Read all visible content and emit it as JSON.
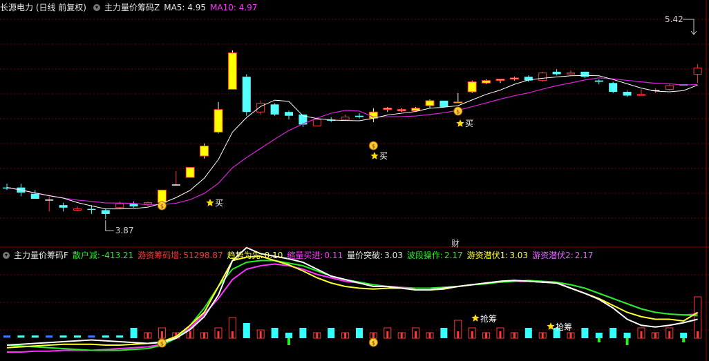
{
  "top_panel": {
    "title": "长源电力 (日线 前复权)",
    "indicator": "主力量价筹码Z",
    "ma5_label": "MA5: 4.95",
    "ma10_label": "MA10: 4.97",
    "high_label": "5.42",
    "low_label": "3.87",
    "buy_label": "买",
    "cai_label": "财"
  },
  "bottom_panel": {
    "indicator": "主力量价筹码F",
    "metrics": [
      {
        "label": "散户减:",
        "value": "-413.21",
        "color": "#22ee22"
      },
      {
        "label": "游资筹码增:",
        "value": "51298.87",
        "color": "#ff3838"
      },
      {
        "label": "趋势为先:",
        "value": "0.10",
        "color": "#ffff33"
      },
      {
        "label": "缩量买进:",
        "value": "0.11",
        "color": "#ff33ff"
      },
      {
        "label": "量价突破:",
        "value": "3.03",
        "color": "#e8e8e8"
      },
      {
        "label": "波段操作:",
        "value": "2.17",
        "color": "#22ee22"
      },
      {
        "label": "游资潜伏1:",
        "value": "3.03",
        "color": "#ffff33"
      },
      {
        "label": "游资潜伏2:",
        "value": "2.17",
        "color": "#e066ff"
      }
    ],
    "grab_label": "抢筹"
  },
  "colors": {
    "up": "#ff3838",
    "down": "#55ffff",
    "yellow": "#ffff00",
    "ma5": "#ffffff",
    "ma10": "#dd22dd",
    "grid": "#7a0000",
    "green_line": "#22ee22",
    "white_line": "#ffffff",
    "yellow_line": "#ffff33",
    "magenta_line": "#ff33ff"
  },
  "candles": [
    {
      "o": 4.12,
      "h": 4.15,
      "l": 4.1,
      "c": 4.12,
      "k": "d"
    },
    {
      "o": 4.12,
      "h": 4.15,
      "l": 4.05,
      "c": 4.08,
      "k": "d"
    },
    {
      "o": 4.07,
      "h": 4.1,
      "l": 4.03,
      "c": 4.03,
      "k": "d"
    },
    {
      "o": 4.02,
      "h": 4.05,
      "l": 3.93,
      "c": 3.99,
      "k": "x"
    },
    {
      "o": 3.98,
      "h": 4.0,
      "l": 3.93,
      "c": 3.96,
      "k": "d"
    },
    {
      "o": 3.95,
      "h": 3.97,
      "l": 3.93,
      "c": 3.94,
      "k": "u"
    },
    {
      "o": 3.95,
      "h": 3.98,
      "l": 3.91,
      "c": 3.95,
      "k": "d"
    },
    {
      "o": 3.94,
      "h": 3.95,
      "l": 3.87,
      "c": 3.91,
      "k": "d"
    },
    {
      "o": 3.96,
      "h": 4.01,
      "l": 3.95,
      "c": 3.99,
      "k": "u"
    },
    {
      "o": 3.99,
      "h": 4.01,
      "l": 3.96,
      "c": 3.97,
      "k": "d"
    },
    {
      "o": 3.99,
      "h": 4.01,
      "l": 3.97,
      "c": 4.0,
      "k": "u"
    },
    {
      "o": 4.0,
      "h": 4.1,
      "l": 3.99,
      "c": 4.1,
      "k": "y"
    },
    {
      "o": 4.14,
      "h": 4.25,
      "l": 4.14,
      "c": 4.14,
      "k": "x"
    },
    {
      "o": 4.2,
      "h": 4.28,
      "l": 4.2,
      "c": 4.28,
      "k": "y"
    },
    {
      "o": 4.37,
      "h": 4.47,
      "l": 4.35,
      "c": 4.45,
      "k": "y"
    },
    {
      "o": 4.56,
      "h": 4.8,
      "l": 4.55,
      "c": 4.74,
      "k": "y"
    },
    {
      "o": 4.9,
      "h": 5.21,
      "l": 4.9,
      "c": 5.19,
      "k": "y"
    },
    {
      "o": 5.0,
      "h": 5.02,
      "l": 4.69,
      "c": 4.72,
      "k": "d"
    },
    {
      "o": 4.79,
      "h": 4.81,
      "l": 4.7,
      "c": 4.72,
      "k": "u"
    },
    {
      "o": 4.78,
      "h": 4.79,
      "l": 4.69,
      "c": 4.7,
      "k": "d"
    },
    {
      "o": 4.72,
      "h": 4.73,
      "l": 4.66,
      "c": 4.69,
      "k": "d"
    },
    {
      "o": 4.7,
      "h": 4.7,
      "l": 4.6,
      "c": 4.62,
      "k": "d"
    },
    {
      "o": 4.66,
      "h": 4.66,
      "l": 4.61,
      "c": 4.61,
      "k": "u"
    },
    {
      "o": 4.65,
      "h": 4.68,
      "l": 4.64,
      "c": 4.66,
      "k": "d"
    },
    {
      "o": 4.66,
      "h": 4.7,
      "l": 4.65,
      "c": 4.68,
      "k": "u"
    },
    {
      "o": 4.69,
      "h": 4.71,
      "l": 4.67,
      "c": 4.68,
      "k": "d"
    },
    {
      "o": 4.67,
      "h": 4.75,
      "l": 4.64,
      "c": 4.72,
      "k": "y"
    },
    {
      "o": 4.75,
      "h": 4.76,
      "l": 4.72,
      "c": 4.74,
      "k": "y"
    },
    {
      "o": 4.74,
      "h": 4.75,
      "l": 4.72,
      "c": 4.73,
      "k": "y"
    },
    {
      "o": 4.73,
      "h": 4.76,
      "l": 4.72,
      "c": 4.75,
      "k": "y"
    },
    {
      "o": 4.77,
      "h": 4.82,
      "l": 4.75,
      "c": 4.81,
      "k": "y"
    },
    {
      "o": 4.81,
      "h": 4.81,
      "l": 4.76,
      "c": 4.76,
      "k": "d"
    },
    {
      "o": 4.8,
      "h": 4.87,
      "l": 4.8,
      "c": 4.8,
      "k": "y"
    },
    {
      "o": 4.88,
      "h": 4.97,
      "l": 4.87,
      "c": 4.96,
      "k": "y"
    },
    {
      "o": 4.95,
      "h": 4.98,
      "l": 4.94,
      "c": 4.97,
      "k": "y"
    },
    {
      "o": 4.97,
      "h": 4.98,
      "l": 4.95,
      "c": 4.98,
      "k": "y"
    },
    {
      "o": 4.99,
      "h": 5.0,
      "l": 4.97,
      "c": 4.99,
      "k": "y"
    },
    {
      "o": 5.0,
      "h": 5.01,
      "l": 4.96,
      "c": 4.97,
      "k": "d"
    },
    {
      "o": 4.97,
      "h": 5.04,
      "l": 4.96,
      "c": 5.03,
      "k": "u"
    },
    {
      "o": 5.04,
      "h": 5.06,
      "l": 5.01,
      "c": 5.02,
      "k": "d"
    },
    {
      "o": 5.03,
      "h": 5.05,
      "l": 5.02,
      "c": 5.03,
      "k": "u"
    },
    {
      "o": 5.04,
      "h": 5.04,
      "l": 4.99,
      "c": 5.0,
      "k": "d"
    },
    {
      "o": 4.97,
      "h": 4.98,
      "l": 4.94,
      "c": 4.96,
      "k": "d"
    },
    {
      "o": 4.95,
      "h": 4.96,
      "l": 4.87,
      "c": 4.88,
      "k": "d"
    },
    {
      "o": 4.88,
      "h": 4.89,
      "l": 4.84,
      "c": 4.85,
      "k": "d"
    },
    {
      "o": 4.86,
      "h": 4.9,
      "l": 4.85,
      "c": 4.86,
      "k": "u"
    },
    {
      "o": 4.89,
      "h": 4.91,
      "l": 4.87,
      "c": 4.88,
      "k": "x"
    },
    {
      "o": 4.9,
      "h": 4.94,
      "l": 4.89,
      "c": 4.93,
      "k": "u"
    },
    {
      "o": 4.94,
      "h": 4.94,
      "l": 4.93,
      "c": 4.93,
      "k": "d"
    },
    {
      "o": 5.02,
      "h": 5.1,
      "l": 4.95,
      "c": 5.07,
      "k": "u"
    }
  ]
}
